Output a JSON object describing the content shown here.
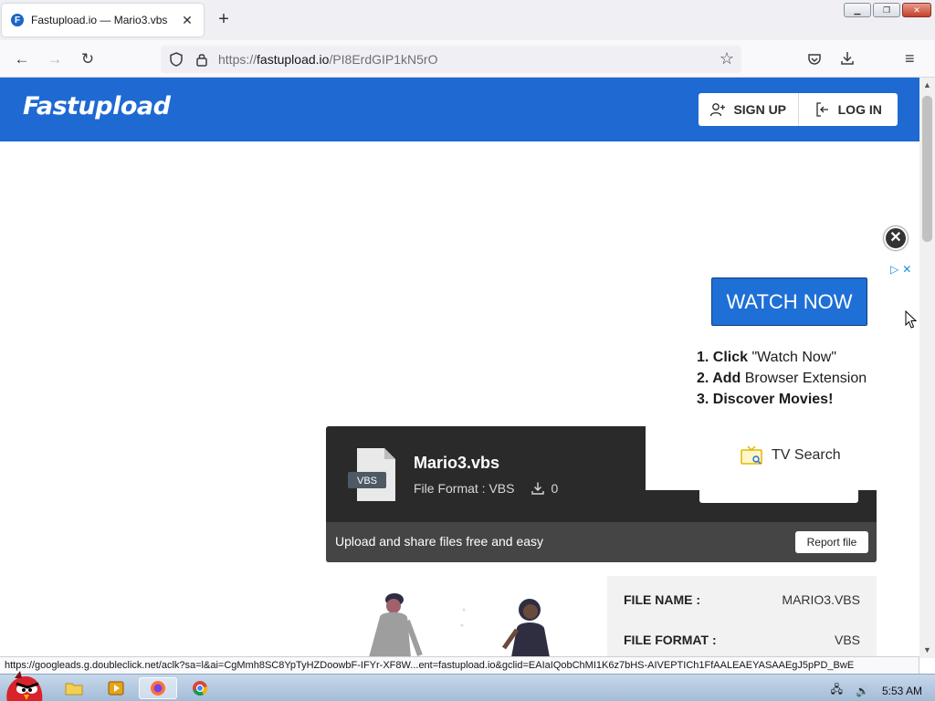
{
  "browser": {
    "tab_title": "Fastupload.io — Mario3.vbs",
    "tab_favicon": "F",
    "new_tab": "+",
    "url_prefix": "https://",
    "url_domain": "fastupload.io",
    "url_path": "/PI8ErdGIP1kN5rO"
  },
  "site": {
    "logo": "Fastupload",
    "sign_up": "SIGN UP",
    "log_in": "LOG IN"
  },
  "ad": {
    "close_glyph": "✕",
    "watch_now": "WATCH NOW",
    "step1_bold": "1. Click",
    "step1_rest": " \"Watch Now\"",
    "step2_bold": "2. Add",
    "step2_rest": " Browser Extension",
    "step3_bold": "3. Discover Movies!",
    "tv_search": "TV Search"
  },
  "file": {
    "icon_label": "VBS",
    "name": "Mario3.vbs",
    "format_line": "File Format : VBS",
    "downloads": "0",
    "tagline": "Upload and share files free and easy",
    "report": "Report file"
  },
  "info": {
    "rows": [
      {
        "label": "FILE NAME :",
        "value": "MARIO3.VBS"
      },
      {
        "label": "FILE FORMAT :",
        "value": "VBS"
      }
    ]
  },
  "status_url": "https://googleads.g.doubleclick.net/aclk?sa=l&ai=CgMmh8SC8YpTyHZDoowbF-IFYr-XF8W...ent=fastupload.io&gclid=EAIaIQobChMI1K6z7bHS-AIVEPTICh1FfAALEAEYASAAEgJ5pPD_BwE",
  "taskbar": {
    "clock": "5:53 AM"
  },
  "colors": {
    "brand_blue": "#1e69d2",
    "card_dark": "#2a2a2a",
    "ad_button": "#1e6fd6"
  }
}
